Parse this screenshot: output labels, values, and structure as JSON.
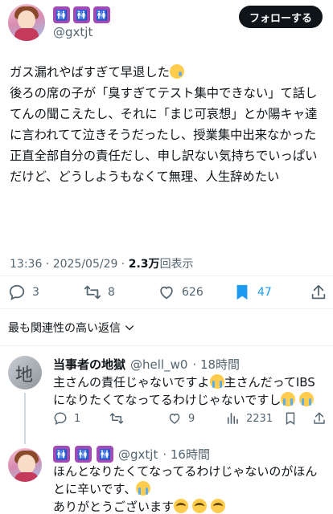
{
  "author": {
    "handle": "@gxtjt",
    "badges": [
      "🚻",
      "🚻",
      "🚻"
    ]
  },
  "follow_button": "フォローする",
  "tweet": {
    "text_line1": "ガス漏れやばすぎて早退した",
    "text_rest": "後ろの席の子が「臭すぎてテスト集中できない」て話してんの聞こえたし、それに「まじ可哀想」とか陽キャ達に言われてて泣きそうだったし、授業集中出来なかった\n正直全部自分の責任だし、申し訳ない気持ちでいっぱいだけど、どうしようもなくて無理、人生辞めたい",
    "time": "13:36 · 2025/05/29 · ",
    "views": "2.3万",
    "views_label": "回表示"
  },
  "actions": {
    "replies": "3",
    "retweets": "8",
    "likes": "626",
    "bookmarks": "47"
  },
  "relevance_label": "最も関連性の高い返信",
  "reply1": {
    "name": "当事者の地獄",
    "handle": "@hell_w0",
    "time": "· 18時間",
    "text_a": "主さんの責任じゃないですよ",
    "text_b": "主さんだってIBSになりたくてなってるわけじゃないですし",
    "replies": "1",
    "likes": "9",
    "views": "2231"
  },
  "reply2": {
    "handle": "@gxtjt",
    "time": "· 16時間",
    "text_a": "ほんとなりたくてなってるわけじゃないのがほんとに辛いです、",
    "text_b": "ありがとうございます"
  },
  "colors": {
    "accent": "#1d9bf0",
    "text": "#0f1419",
    "muted": "#536471",
    "badge": "#a24bb7"
  }
}
